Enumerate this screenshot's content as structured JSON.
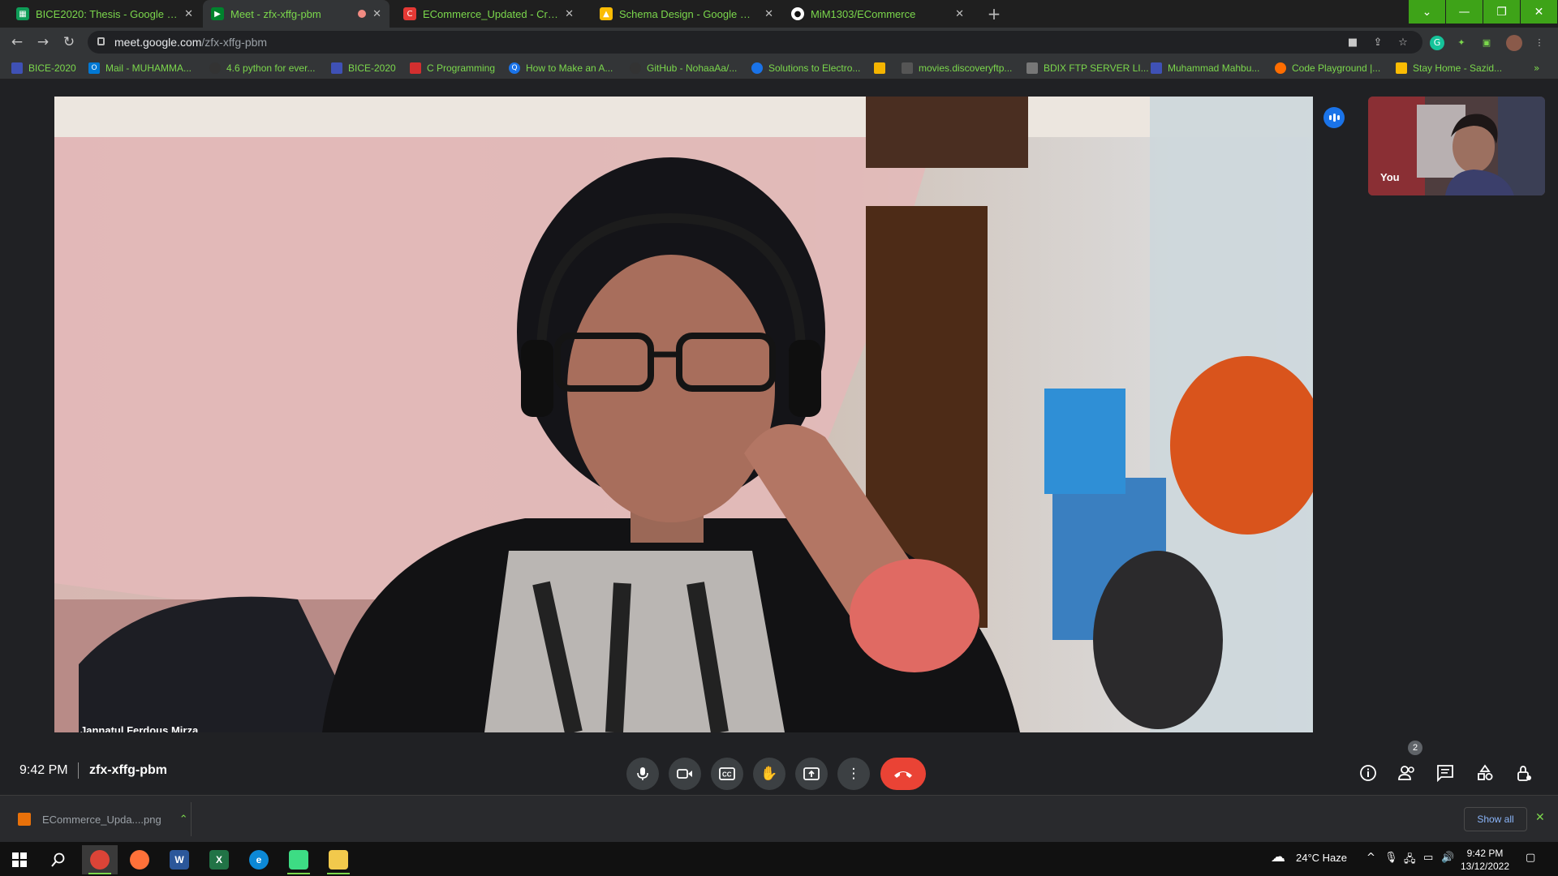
{
  "browser": {
    "tabs": [
      {
        "label": "BICE2020: Thesis - Google Sheets",
        "icon": "google-sheets-icon",
        "color": "#0f9d58"
      },
      {
        "label": "Meet - zfx-xffg-pbm",
        "icon": "google-meet-icon",
        "color": "#00832d"
      },
      {
        "label": "ECommerce_Updated - Creately",
        "icon": "creately-icon",
        "color": "#e53935"
      },
      {
        "label": "Schema Design - Google Drive",
        "icon": "google-drive-icon",
        "color": "#fbbc04"
      },
      {
        "label": "MiM1303/ECommerce",
        "icon": "github-icon",
        "color": "#ffffff"
      }
    ],
    "url_host": "meet.google.com",
    "url_path": "/zfx-xffg-pbm",
    "bookmarks": [
      {
        "label": "BICE-2020",
        "color": "#3f51b5"
      },
      {
        "label": "Mail - MUHAMMA...",
        "color": "#0078d4"
      },
      {
        "label": "4.6 python for ever...",
        "color": "#333333"
      },
      {
        "label": "BICE-2020",
        "color": "#3f51b5"
      },
      {
        "label": "C Programming",
        "color": "#d32f2f"
      },
      {
        "label": "How to Make an A...",
        "color": "#1a73e8"
      },
      {
        "label": "GitHub - NohaaAa/...",
        "color": "#333333"
      },
      {
        "label": "Solutions to Electro...",
        "color": "#1a73e8"
      },
      {
        "label": "",
        "color": "#f4b400"
      },
      {
        "label": "movies.discoveryftp...",
        "color": "#555555"
      },
      {
        "label": "BDIX FTP SERVER LI...",
        "color": "#777777"
      },
      {
        "label": "Muhammad Mahbu...",
        "color": "#3f51b5"
      },
      {
        "label": "Code Playground |...",
        "color": "#ff6d00"
      },
      {
        "label": "Stay Home - Sazid...",
        "color": "#fbbc04"
      }
    ],
    "accent": "#7bd74c"
  },
  "meet": {
    "main_participant": "Jannatul Ferdous Mirza",
    "self_label": "You",
    "time": "9:42 PM",
    "meeting_code": "zfx-xffg-pbm",
    "people_count": "2",
    "controls": [
      "mic-icon",
      "camera-icon",
      "captions-icon",
      "raise-hand-icon",
      "present-icon",
      "more-options-icon",
      "end-call-icon"
    ],
    "right_controls": [
      "info-icon",
      "people-icon",
      "chat-icon",
      "activities-icon",
      "host-controls-icon"
    ]
  },
  "downloads": {
    "file": "ECommerce_Upda....png",
    "show_all": "Show all"
  },
  "taskbar": {
    "weather": "24°C  Haze",
    "time": "9:42 PM",
    "date": "13/12/2022"
  }
}
